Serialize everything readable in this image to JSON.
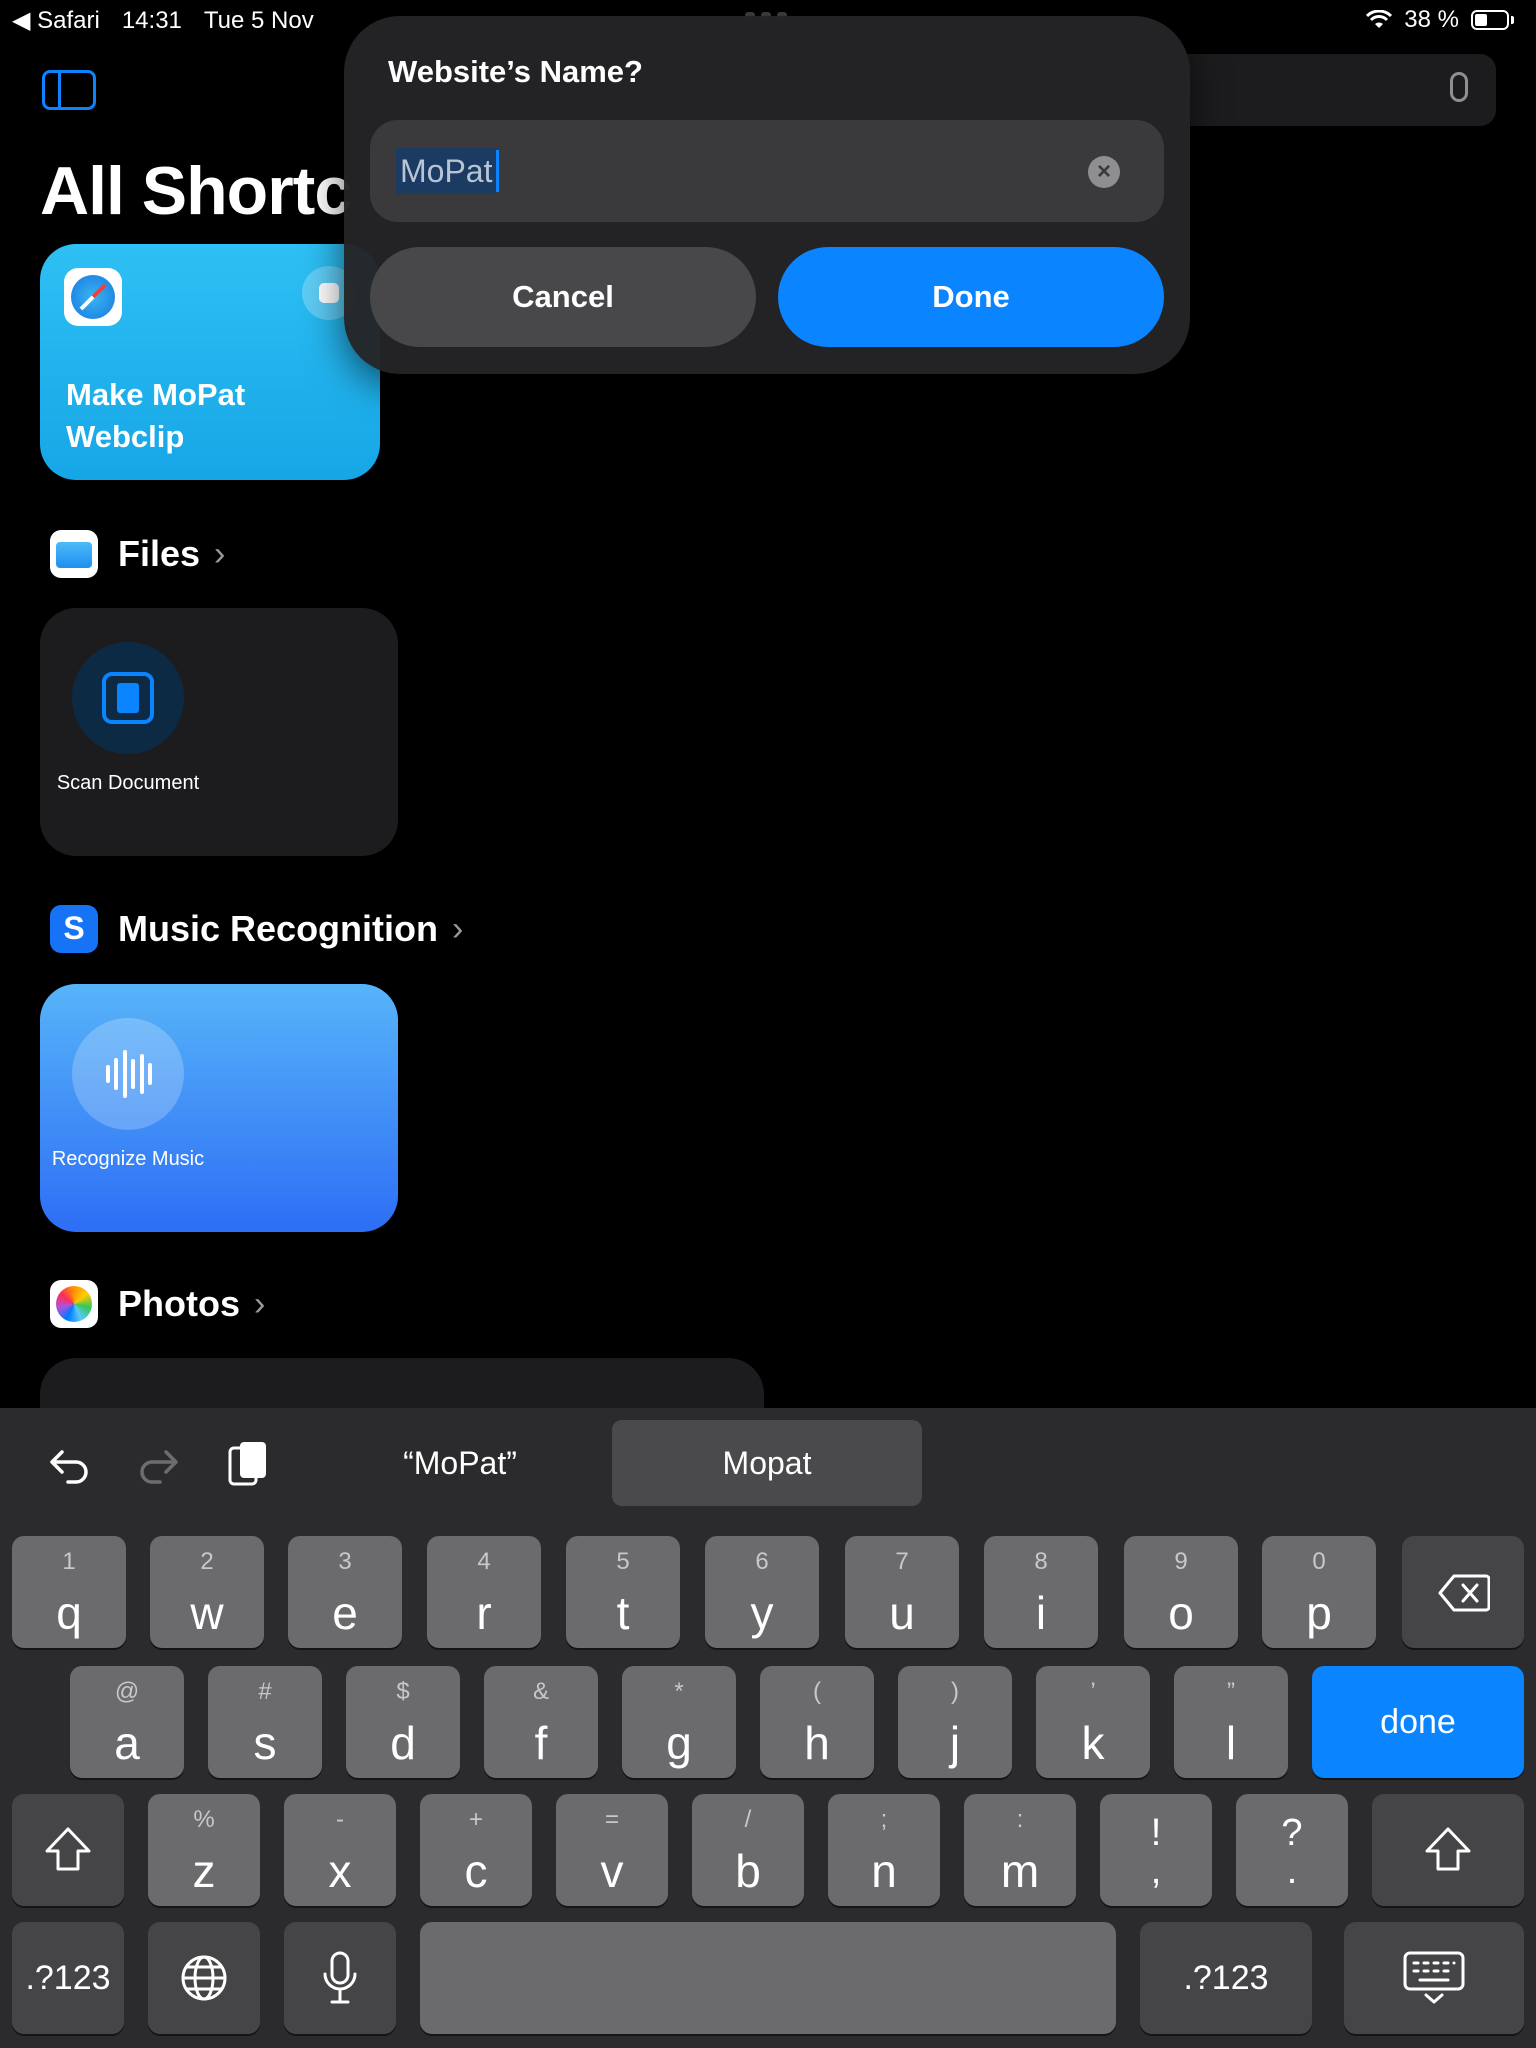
{
  "status_bar": {
    "back_app": "◀ Safari",
    "time": "14:31",
    "date": "Tue 5 Nov",
    "battery": "38 %"
  },
  "background": {
    "title": "All Shortc",
    "webclip_card": {
      "title": "Make MoPat Webclip"
    },
    "sections": [
      {
        "name": "Files",
        "action": "Scan Document"
      },
      {
        "name": "Music Recognition",
        "action": "Recognize Music"
      },
      {
        "name": "Photos"
      }
    ]
  },
  "dialog": {
    "title": "Website’s Name?",
    "field_value": "MoPat",
    "cancel_label": "Cancel",
    "done_label": "Done"
  },
  "keyboard": {
    "suggestions": [
      "“MoPat”",
      "Mopat"
    ],
    "row1": [
      {
        "hint": "1",
        "main": "q"
      },
      {
        "hint": "2",
        "main": "w"
      },
      {
        "hint": "3",
        "main": "e"
      },
      {
        "hint": "4",
        "main": "r"
      },
      {
        "hint": "5",
        "main": "t"
      },
      {
        "hint": "6",
        "main": "y"
      },
      {
        "hint": "7",
        "main": "u"
      },
      {
        "hint": "8",
        "main": "i"
      },
      {
        "hint": "9",
        "main": "o"
      },
      {
        "hint": "0",
        "main": "p"
      }
    ],
    "row2": [
      {
        "hint": "@",
        "main": "a"
      },
      {
        "hint": "#",
        "main": "s"
      },
      {
        "hint": "$",
        "main": "d"
      },
      {
        "hint": "&",
        "main": "f"
      },
      {
        "hint": "*",
        "main": "g"
      },
      {
        "hint": "(",
        "main": "h"
      },
      {
        "hint": ")",
        "main": "j"
      },
      {
        "hint": "’",
        "main": "k"
      },
      {
        "hint": "”",
        "main": "l"
      }
    ],
    "row3": [
      {
        "hint": "%",
        "main": "z"
      },
      {
        "hint": "-",
        "main": "x"
      },
      {
        "hint": "+",
        "main": "c"
      },
      {
        "hint": "=",
        "main": "v"
      },
      {
        "hint": "/",
        "main": "b"
      },
      {
        "hint": ";",
        "main": "n"
      },
      {
        "hint": ":",
        "main": "m"
      }
    ],
    "punct1": {
      "top": "!",
      "bottom": ","
    },
    "punct2": {
      "top": "?",
      "bottom": "."
    },
    "done_key": "done",
    "numbers_key": ".?123"
  }
}
